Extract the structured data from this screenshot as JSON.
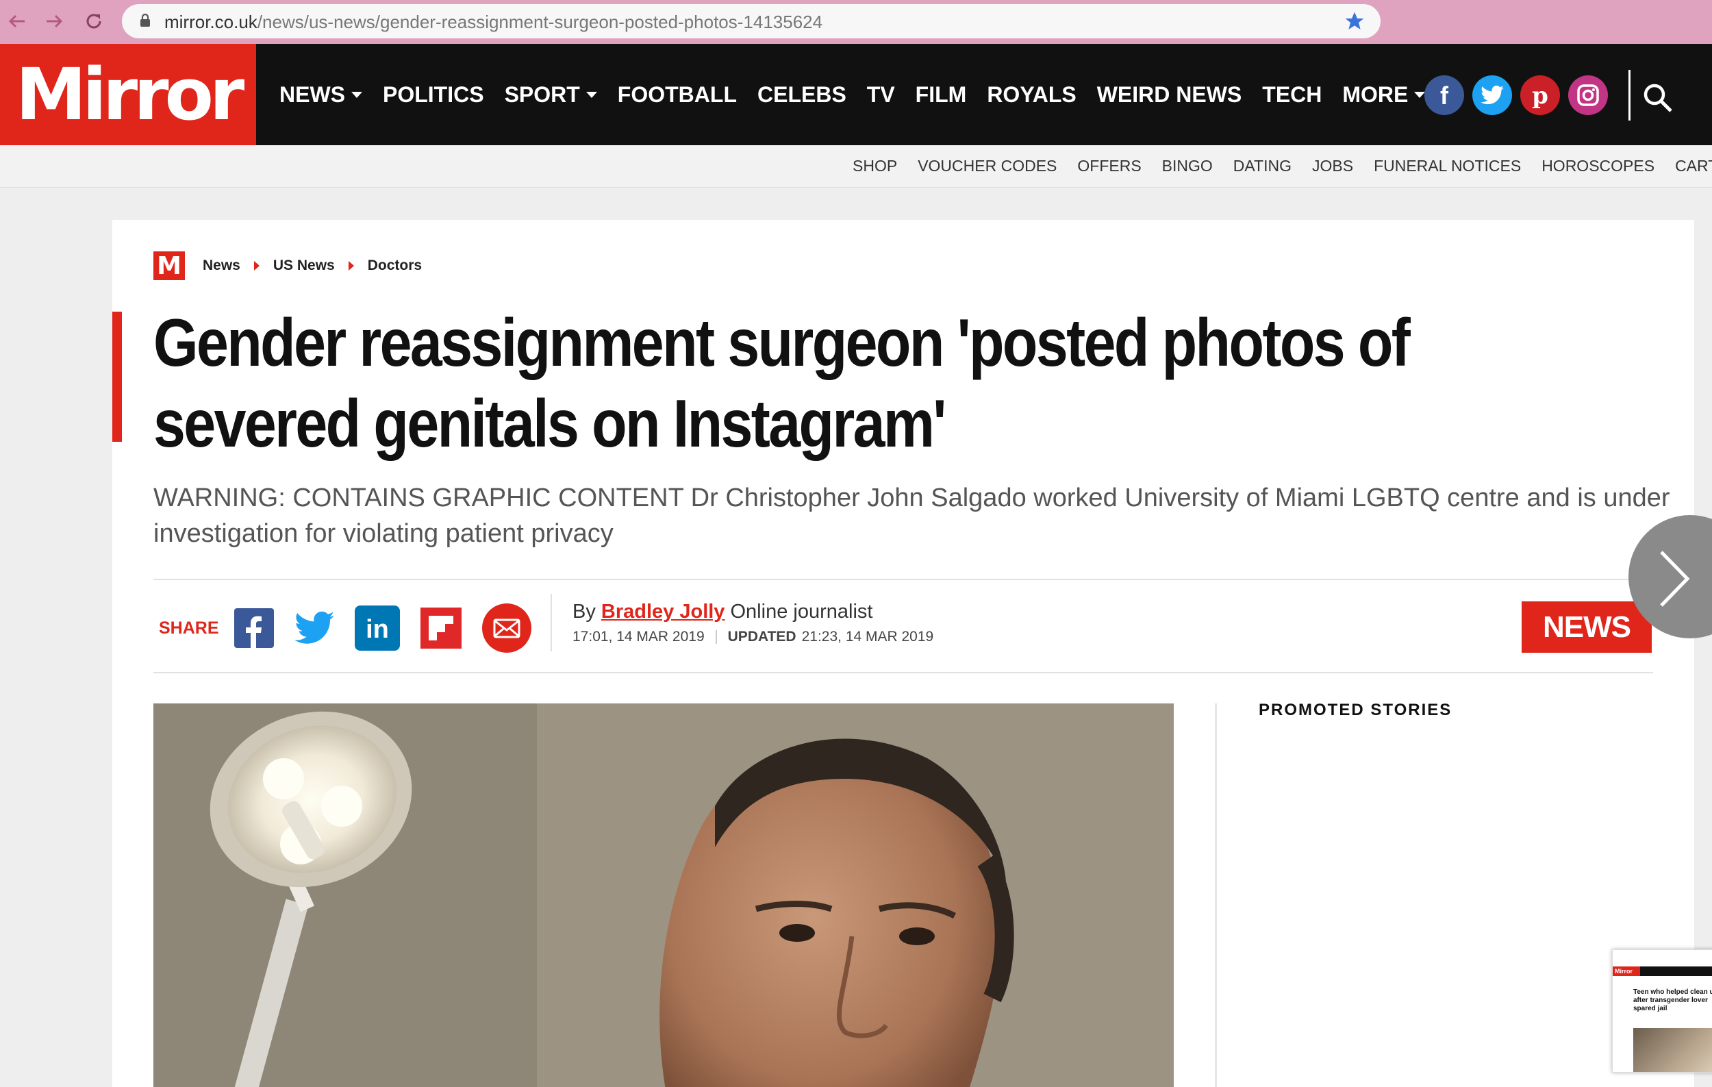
{
  "browser": {
    "url_domain": "mirror.co.uk",
    "url_path": "/news/us-news/gender-reassignment-surgeon-posted-photos-14135624"
  },
  "header": {
    "logo_text": "Mirror",
    "nav": [
      {
        "label": "NEWS",
        "has_dropdown": true
      },
      {
        "label": "POLITICS",
        "has_dropdown": false
      },
      {
        "label": "SPORT",
        "has_dropdown": true
      },
      {
        "label": "FOOTBALL",
        "has_dropdown": false
      },
      {
        "label": "CELEBS",
        "has_dropdown": false
      },
      {
        "label": "TV",
        "has_dropdown": false
      },
      {
        "label": "FILM",
        "has_dropdown": false
      },
      {
        "label": "ROYALS",
        "has_dropdown": false
      },
      {
        "label": "WEIRD NEWS",
        "has_dropdown": false
      },
      {
        "label": "TECH",
        "has_dropdown": false
      },
      {
        "label": "MORE",
        "has_dropdown": true
      }
    ],
    "social": [
      {
        "icon": "facebook-icon",
        "glyph": "f",
        "color": "#3b5998"
      },
      {
        "icon": "twitter-icon",
        "glyph": "t",
        "color": "#1da1f2"
      },
      {
        "icon": "pinterest-icon",
        "glyph": "p",
        "color": "#cb2027"
      },
      {
        "icon": "instagram-icon",
        "glyph": "i",
        "color": "#c13584"
      }
    ]
  },
  "subnav": [
    "SHOP",
    "VOUCHER CODES",
    "OFFERS",
    "BINGO",
    "DATING",
    "JOBS",
    "FUNERAL NOTICES",
    "HOROSCOPES",
    "CARTOONS"
  ],
  "article": {
    "badge": "M",
    "breadcrumb": [
      "News",
      "US News",
      "Doctors"
    ],
    "headline": "Gender reassignment surgeon 'posted photos of severed genitals on Instagram'",
    "standfirst": "WARNING: CONTAINS GRAPHIC CONTENT Dr Christopher John Salgado worked University of Miami LGBTQ centre and is under investigation for violating patient privacy",
    "share_label": "SHARE",
    "byline_prefix": "By",
    "author": "Bradley Jolly",
    "author_role": "Online journalist",
    "published": "17:01, 14 MAR 2019",
    "updated_label": "UPDATED",
    "updated": "21:23, 14 MAR 2019",
    "section_tag": "NEWS"
  },
  "sidebar": {
    "promoted_title": "PROMOTED STORIES"
  },
  "teaser": {
    "logo": "Mirror",
    "title": "Teen who helped clean up after transgender lover spared jail"
  },
  "colors": {
    "brand_red": "#e0251b",
    "header_black": "#111111",
    "chrome_pink": "#dfa3bf"
  }
}
